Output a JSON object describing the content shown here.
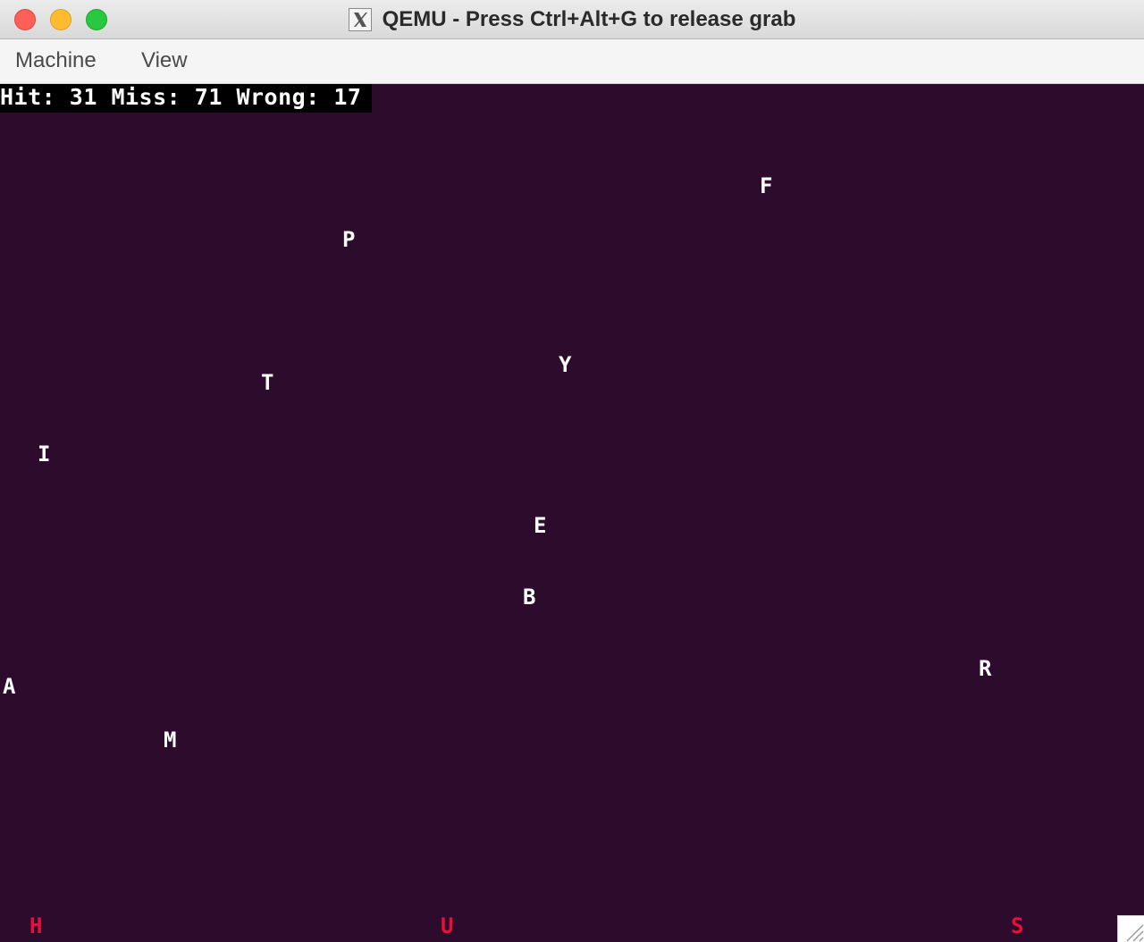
{
  "window": {
    "title": "QEMU - Press Ctrl+Alt+G to release grab"
  },
  "menu": {
    "items": [
      {
        "label": "Machine"
      },
      {
        "label": "View"
      }
    ]
  },
  "game": {
    "status": {
      "hit_label": "Hit:",
      "hit": "31",
      "miss_label": "Miss:",
      "miss": "71",
      "wrong_label": "Wrong:",
      "wrong": "17"
    },
    "letters": [
      "F",
      "P",
      "Y",
      "T",
      "I",
      "E",
      "B",
      "R",
      "A",
      "M",
      "H",
      "U",
      "S"
    ],
    "colors": {
      "background": "#2c0b2c",
      "letter": "#ffffff",
      "letter_bottom": "#e8103a",
      "status_bg": "#000000"
    }
  }
}
